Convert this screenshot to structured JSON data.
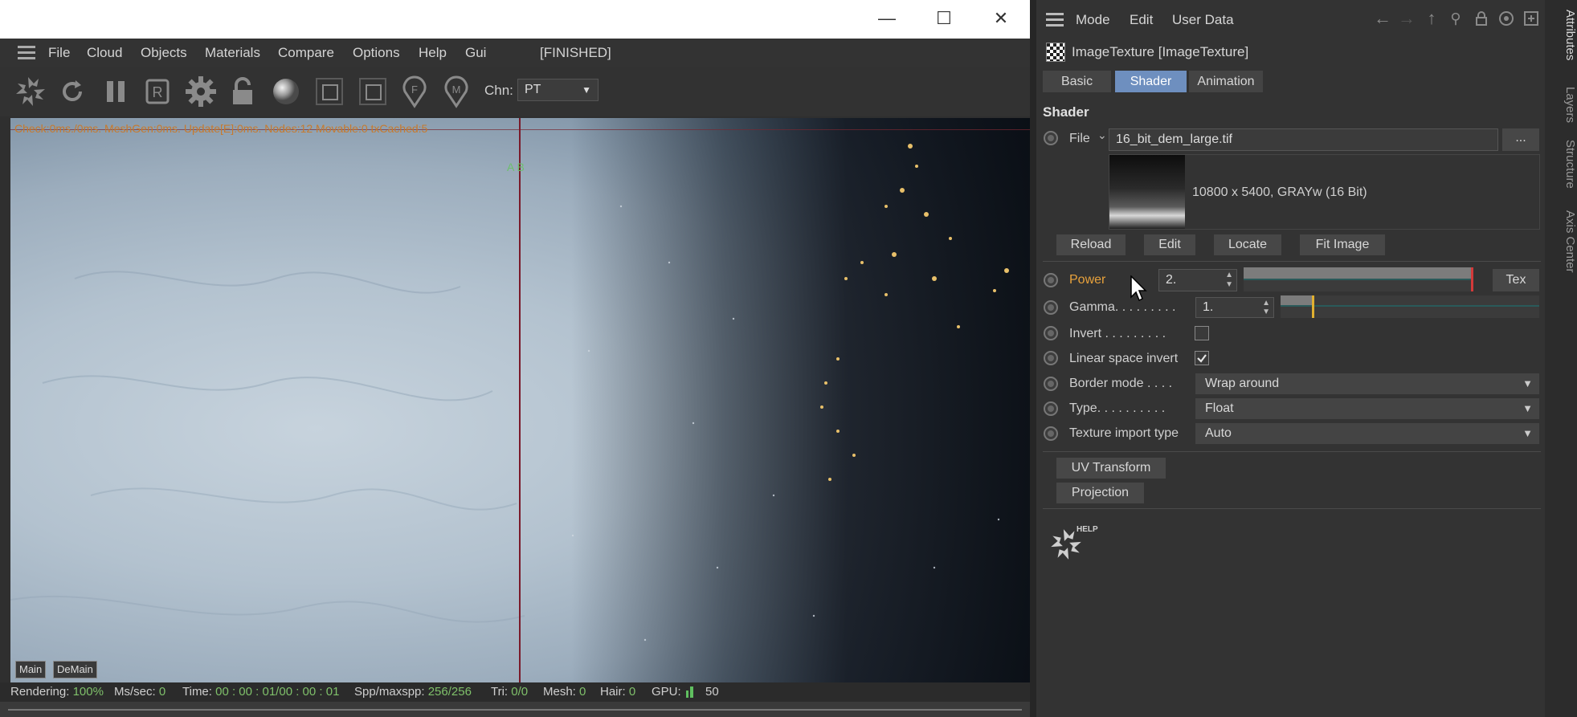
{
  "window": {
    "controls": {
      "minimize": "—",
      "maximize": "☐",
      "close": "✕"
    }
  },
  "menubar": {
    "items": [
      "File",
      "Cloud",
      "Objects",
      "Materials",
      "Compare",
      "Options",
      "Help",
      "Gui"
    ],
    "status": "[FINISHED]"
  },
  "toolbar": {
    "channel_label": "Chn:",
    "channel_value": "PT",
    "tool_icons": [
      "octane-logo-icon",
      "refresh-icon",
      "pause-icon",
      "region-icon",
      "settings-gear-icon",
      "lock-icon",
      "material-ball-icon",
      "frame-icon",
      "frame-alt-icon",
      "pin-f-icon",
      "pin-m-icon"
    ]
  },
  "viewport": {
    "stats": "Check:0ms./0ms. MeshGen:0ms. Update[E]:0ms. Nodes:12 Movable:0 txCached:5",
    "ab_marker": "A B",
    "tabs": [
      "Main",
      "DeMain"
    ]
  },
  "statusbar": {
    "rendering_label": "Rendering:",
    "rendering_value": "100%",
    "mssec_label": "Ms/sec:",
    "mssec_value": "0",
    "time_label": "Time:",
    "time_value": "00 : 00 : 01/00 : 00 : 01",
    "spp_label": "Spp/maxspp:",
    "spp_value": "256/256",
    "tri_label": "Tri:",
    "tri_value": "0/0",
    "mesh_label": "Mesh:",
    "mesh_value": "0",
    "hair_label": "Hair:",
    "hair_value": "0",
    "gpu_label": "GPU:",
    "gpu_value": "50"
  },
  "attributes": {
    "menu": [
      "Mode",
      "Edit",
      "User Data"
    ],
    "object_title": "ImageTexture [ImageTexture]",
    "tabs": [
      "Basic",
      "Shader",
      "Animation"
    ],
    "active_tab": "Shader",
    "section": "Shader",
    "file_label": "File",
    "file_value": "16_bit_dem_large.tif",
    "browse_label": "...",
    "image_info": "10800 x 5400, GRAYw (16 Bit)",
    "buttons": [
      "Reload",
      "Edit",
      "Locate",
      "Fit Image"
    ],
    "power_label": "Power",
    "power_value": "2.",
    "power_fill": 1.0,
    "tex_label": "Tex",
    "gamma_label": "Gamma. . . . . . . . .",
    "gamma_value": "1.",
    "gamma_fill": 0.12,
    "invert_label": "Invert . . . . . . . . .",
    "invert_checked": false,
    "linear_label": "Linear space invert",
    "linear_checked": true,
    "border_label": "Border mode . . . .",
    "border_value": "Wrap around",
    "type_label": "Type. . . . . . . . . .",
    "type_value": "Float",
    "import_label": "Texture import type",
    "import_value": "Auto",
    "uv_button": "UV Transform",
    "projection_button": "Projection",
    "help_label": "HELP"
  },
  "side_tabs": [
    "Attributes",
    "Layers",
    "Structure",
    "Axis Center"
  ],
  "colors": {
    "accent": "#6e8fbf",
    "power_label": "#e8a23c",
    "status_value": "#7fc06a",
    "overlay_text": "#c77a2d"
  }
}
